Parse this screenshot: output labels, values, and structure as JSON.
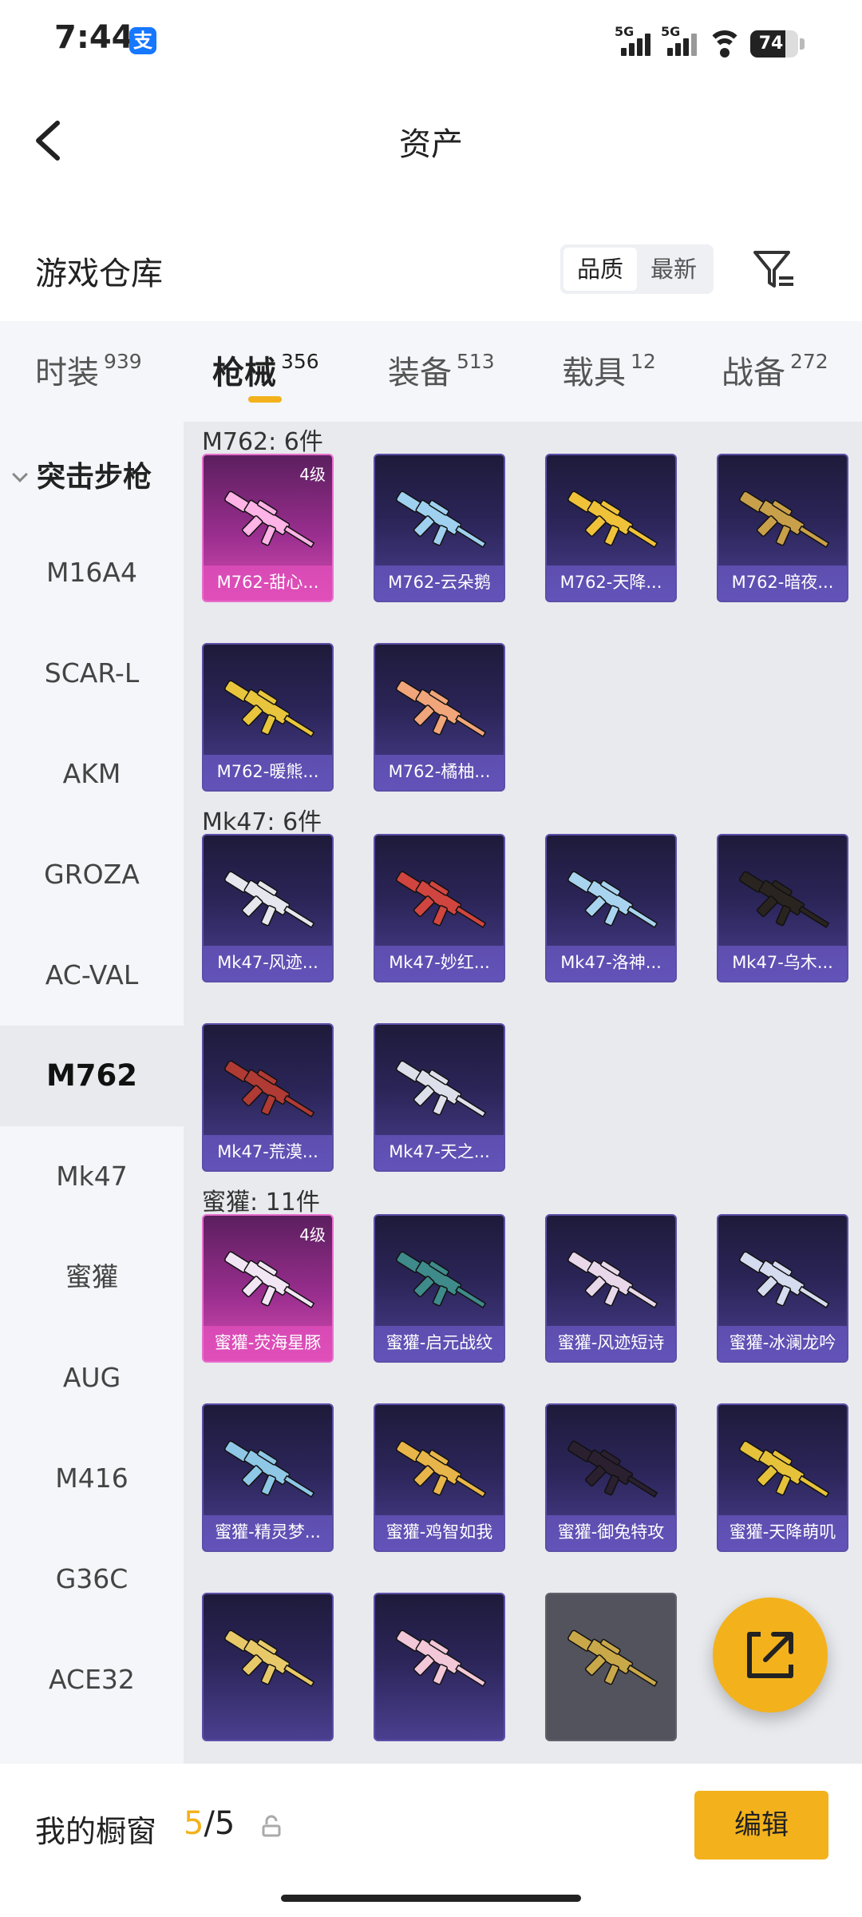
{
  "status_bar": {
    "time": "7:44",
    "app_badge": "支",
    "signal_1": "5G",
    "signal_2": "5G",
    "battery": "74"
  },
  "header": {
    "title": "资产"
  },
  "section": {
    "title": "游戏仓库",
    "sort_options": [
      "品质",
      "最新"
    ],
    "sort_selected": "品质"
  },
  "tabs": [
    {
      "label": "时装",
      "count": "939"
    },
    {
      "label": "枪械",
      "count": "356"
    },
    {
      "label": "装备",
      "count": "513"
    },
    {
      "label": "载具",
      "count": "12"
    },
    {
      "label": "战备",
      "count": "272"
    }
  ],
  "active_tab": "枪械",
  "sidebar": {
    "category": "突击步枪",
    "items": [
      "M16A4",
      "SCAR-L",
      "AKM",
      "GROZA",
      "AC-VAL",
      "M762",
      "Mk47",
      "蜜獾",
      "AUG",
      "M416",
      "G36C",
      "ACE32"
    ],
    "active": "M762"
  },
  "groups": [
    {
      "title": "M762: 6件",
      "items": [
        {
          "name": "M762-甜心...",
          "level": "4级",
          "rarity": "pink",
          "gun_color": "#ffb3e6"
        },
        {
          "name": "M762-云朵鹅",
          "rarity": "purple",
          "gun_color": "#9fd0ef"
        },
        {
          "name": "M762-天降...",
          "rarity": "purple",
          "gun_color": "#f0c23a"
        },
        {
          "name": "M762-暗夜...",
          "rarity": "purple",
          "gun_color": "#c9a04a"
        },
        {
          "name": "M762-暖熊...",
          "rarity": "purple",
          "gun_color": "#e8c53c"
        },
        {
          "name": "M762-橘柚...",
          "rarity": "purple",
          "gun_color": "#f0a57a"
        }
      ]
    },
    {
      "title": "Mk47: 6件",
      "items": [
        {
          "name": "Mk47-风迹...",
          "rarity": "purple",
          "gun_color": "#e6e6ee"
        },
        {
          "name": "Mk47-妙红...",
          "rarity": "purple",
          "gun_color": "#d0453f"
        },
        {
          "name": "Mk47-洛神...",
          "rarity": "purple",
          "gun_color": "#a9d4ef"
        },
        {
          "name": "Mk47-乌木...",
          "rarity": "purple",
          "gun_color": "#2a2420"
        },
        {
          "name": "Mk47-荒漠...",
          "rarity": "purple",
          "gun_color": "#b03a34"
        },
        {
          "name": "Mk47-天之...",
          "rarity": "purple",
          "gun_color": "#dde0ea"
        }
      ]
    },
    {
      "title": "蜜獾: 11件",
      "items": [
        {
          "name": "蜜獾-荧海星豚",
          "level": "4级",
          "rarity": "pink",
          "gun_color": "#f2e6f4"
        },
        {
          "name": "蜜獾-启元战纹",
          "rarity": "purple",
          "gun_color": "#3f8a8a"
        },
        {
          "name": "蜜獾-风迹短诗",
          "rarity": "purple",
          "gun_color": "#e8d8ea"
        },
        {
          "name": "蜜獾-冰澜龙吟",
          "rarity": "purple",
          "gun_color": "#d6dcef"
        },
        {
          "name": "蜜獾-精灵梦...",
          "rarity": "purple",
          "gun_color": "#8fc7e6"
        },
        {
          "name": "蜜獾-鸡智如我",
          "rarity": "purple",
          "gun_color": "#e8b54a"
        },
        {
          "name": "蜜獾-御兔特攻",
          "rarity": "purple",
          "gun_color": "#2a2030"
        },
        {
          "name": "蜜獾-天降萌叽",
          "rarity": "purple",
          "gun_color": "#e6c23a"
        },
        {
          "name": "",
          "rarity": "purple",
          "gun_color": "#e8c96a"
        },
        {
          "name": "",
          "rarity": "purple",
          "gun_color": "#f2c7d8"
        },
        {
          "name": "",
          "rarity": "grey",
          "gun_color": "#c9a84a"
        }
      ]
    }
  ],
  "bottom": {
    "label": "我的橱窗",
    "current": "5",
    "total": "/5",
    "edit": "编辑"
  },
  "colors": {
    "accent": "#f3b21c",
    "card_purple": "#2b2558",
    "card_pink": "#b13aa0"
  }
}
